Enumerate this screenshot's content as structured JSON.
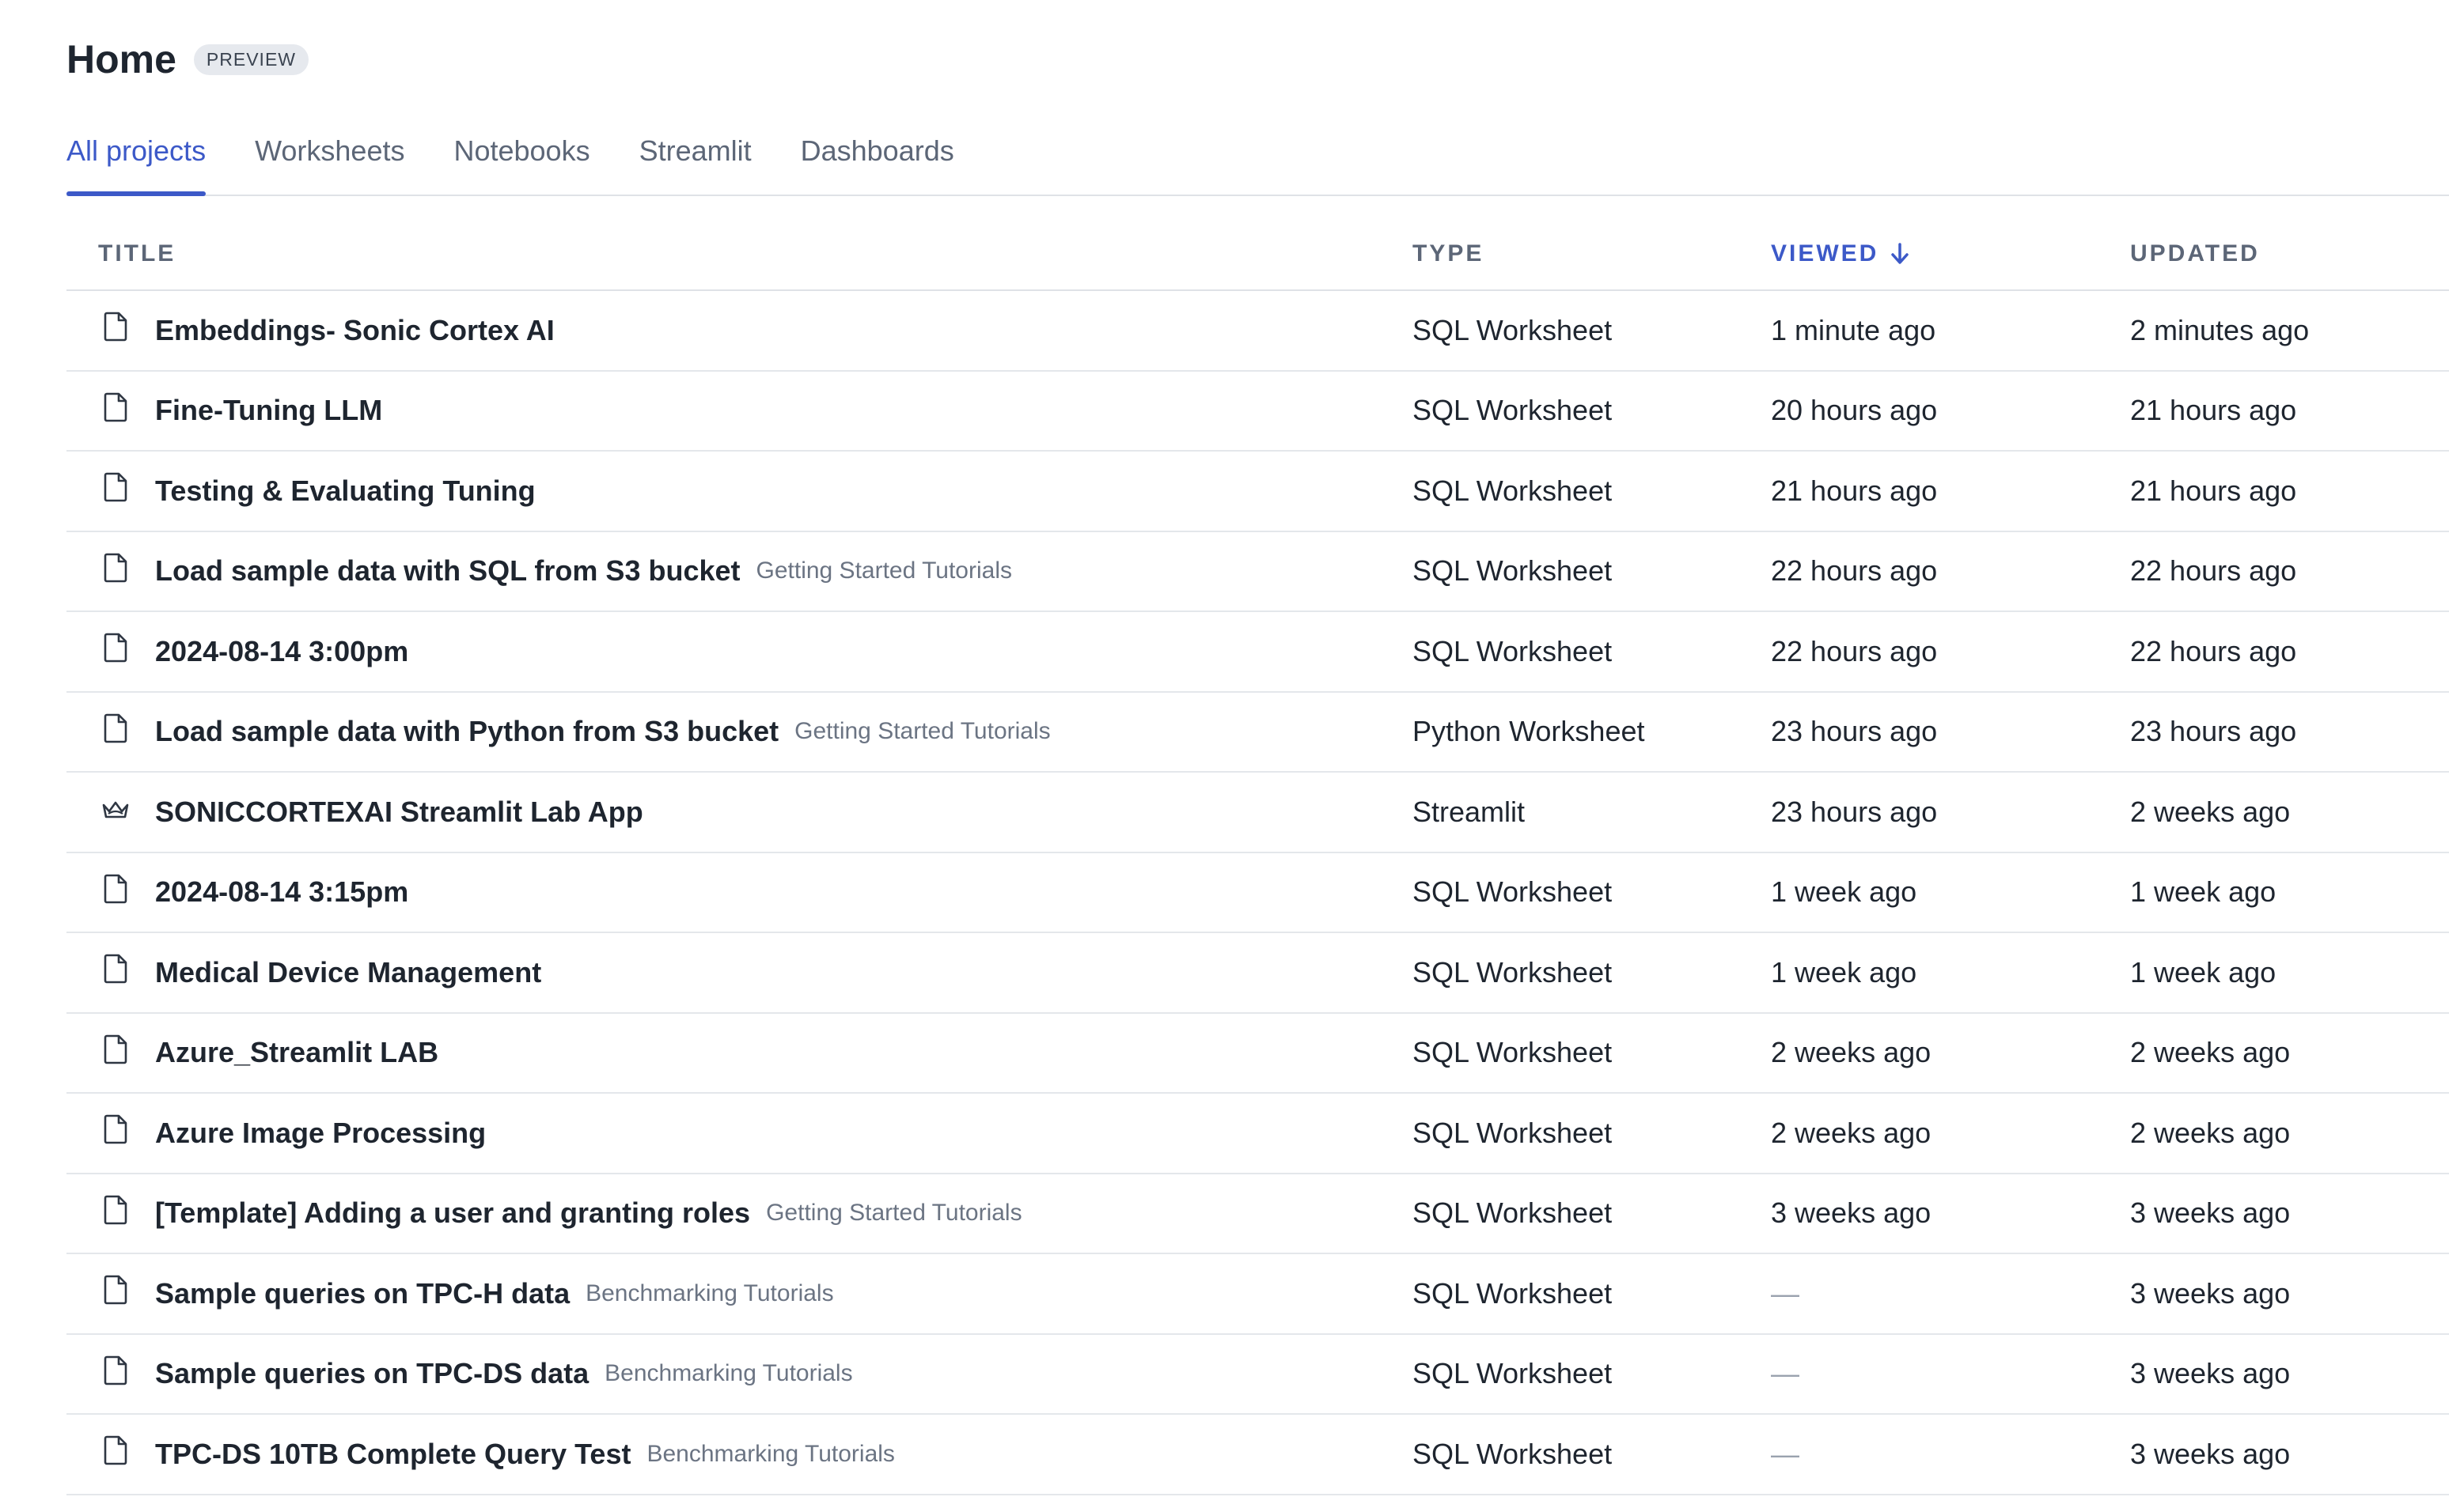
{
  "header": {
    "title": "Home",
    "badge": "PREVIEW"
  },
  "tabs": [
    {
      "label": "All projects",
      "active": true
    },
    {
      "label": "Worksheets",
      "active": false
    },
    {
      "label": "Notebooks",
      "active": false
    },
    {
      "label": "Streamlit",
      "active": false
    },
    {
      "label": "Dashboards",
      "active": false
    }
  ],
  "table": {
    "columns": {
      "title": "TITLE",
      "type": "TYPE",
      "viewed": "VIEWED",
      "updated": "UPDATED"
    },
    "sort": {
      "column": "viewed",
      "direction": "descending",
      "icon": "arrow-down-icon"
    },
    "rows": [
      {
        "icon": "file-icon",
        "title": "Embeddings- Sonic Cortex AI",
        "tag": "",
        "type": "SQL Worksheet",
        "viewed": "1 minute ago",
        "updated": "2 minutes ago"
      },
      {
        "icon": "file-icon",
        "title": "Fine-Tuning LLM",
        "tag": "",
        "type": "SQL Worksheet",
        "viewed": "20 hours ago",
        "updated": "21 hours ago"
      },
      {
        "icon": "file-icon",
        "title": "Testing & Evaluating Tuning",
        "tag": "",
        "type": "SQL Worksheet",
        "viewed": "21 hours ago",
        "updated": "21 hours ago"
      },
      {
        "icon": "file-icon",
        "title": "Load sample data with SQL from S3 bucket",
        "tag": "Getting Started Tutorials",
        "type": "SQL Worksheet",
        "viewed": "22 hours ago",
        "updated": "22 hours ago"
      },
      {
        "icon": "file-icon",
        "title": "2024-08-14 3:00pm",
        "tag": "",
        "type": "SQL Worksheet",
        "viewed": "22 hours ago",
        "updated": "22 hours ago"
      },
      {
        "icon": "file-icon",
        "title": "Load sample data with Python from S3 bucket",
        "tag": "Getting Started Tutorials",
        "type": "Python Worksheet",
        "viewed": "23 hours ago",
        "updated": "23 hours ago"
      },
      {
        "icon": "crown-icon",
        "title": "SONICCORTEXAI Streamlit Lab App",
        "tag": "",
        "type": "Streamlit",
        "viewed": "23 hours ago",
        "updated": "2 weeks ago"
      },
      {
        "icon": "file-icon",
        "title": "2024-08-14 3:15pm",
        "tag": "",
        "type": "SQL Worksheet",
        "viewed": "1 week ago",
        "updated": "1 week ago"
      },
      {
        "icon": "file-icon",
        "title": "Medical Device Management",
        "tag": "",
        "type": "SQL Worksheet",
        "viewed": "1 week ago",
        "updated": "1 week ago"
      },
      {
        "icon": "file-icon",
        "title": "Azure_Streamlit LAB",
        "tag": "",
        "type": "SQL Worksheet",
        "viewed": "2 weeks ago",
        "updated": "2 weeks ago"
      },
      {
        "icon": "file-icon",
        "title": "Azure Image Processing",
        "tag": "",
        "type": "SQL Worksheet",
        "viewed": "2 weeks ago",
        "updated": "2 weeks ago"
      },
      {
        "icon": "file-icon",
        "title": "[Template] Adding a user and granting roles",
        "tag": "Getting Started Tutorials",
        "type": "SQL Worksheet",
        "viewed": "3 weeks ago",
        "updated": "3 weeks ago"
      },
      {
        "icon": "file-icon",
        "title": "Sample queries on TPC-H data",
        "tag": "Benchmarking Tutorials",
        "type": "SQL Worksheet",
        "viewed": "—",
        "updated": "3 weeks ago"
      },
      {
        "icon": "file-icon",
        "title": "Sample queries on TPC-DS data",
        "tag": "Benchmarking Tutorials",
        "type": "SQL Worksheet",
        "viewed": "—",
        "updated": "3 weeks ago"
      },
      {
        "icon": "file-icon",
        "title": "TPC-DS 10TB Complete Query Test",
        "tag": "Benchmarking Tutorials",
        "type": "SQL Worksheet",
        "viewed": "—",
        "updated": "3 weeks ago"
      }
    ]
  }
}
